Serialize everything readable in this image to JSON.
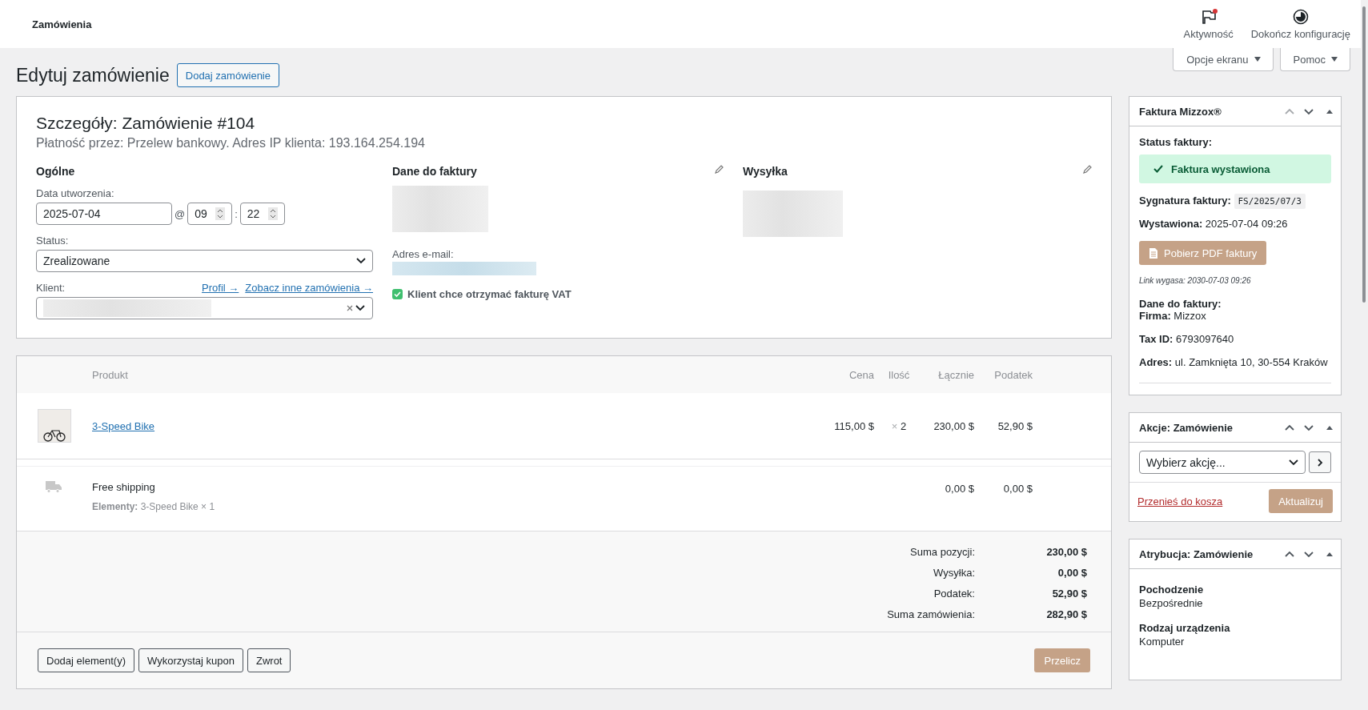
{
  "top_bar": {
    "title": "Zamówienia",
    "actions": [
      {
        "kind": "flag",
        "label": "Aktywność",
        "unread": true
      },
      {
        "kind": "progress",
        "label": "Dokończ konfigurację",
        "unread": false
      }
    ]
  },
  "screen_tabs": [
    "Opcje ekranu",
    "Pomoc"
  ],
  "page": {
    "title": "Edytuj zamówienie",
    "add_button": "Dodaj zamówienie"
  },
  "order": {
    "heading": "Szczegóły: Zamówienie #104",
    "subheading": "Płatność przez: Przelew bankowy. Adres IP klienta: 193.164.254.194",
    "general": {
      "heading": "Ogólne",
      "date_label": "Data utworzenia:",
      "date": "2025-07-04",
      "at": "@",
      "hour": "09",
      "colon": ":",
      "minute": "22",
      "status_label": "Status:",
      "status": "Zrealizowane",
      "client_label": "Klient:",
      "links": [
        "Profil →",
        "Zobacz inne zamówienia →"
      ]
    },
    "billing": {
      "heading": "Dane do faktury",
      "email_label": "Adres e-mail:",
      "vat_label": "Klient chce otrzymać fakturę VAT",
      "vat_checked": true
    },
    "shipping": {
      "heading": "Wysyłka"
    }
  },
  "items": {
    "columns": [
      "Produkt",
      "Cena",
      "Ilość",
      "Łącznie",
      "Podatek"
    ],
    "rows": [
      {
        "kind": "product",
        "name": "3-Speed Bike",
        "cost": "115,00 $",
        "qty_sign": "×",
        "qty": "2",
        "total": "230,00 $",
        "tax": "52,90 $"
      },
      {
        "kind": "shipping",
        "name": "Free shipping",
        "meta_label": "Elementy:",
        "meta_value": "3-Speed Bike × 1",
        "total": "0,00 $",
        "tax": "0,00 $"
      }
    ],
    "totals": [
      {
        "label": "Suma pozycji:",
        "value": "230,00 $"
      },
      {
        "label": "Wysyłka:",
        "value": "0,00 $"
      },
      {
        "label": "Podatek:",
        "value": "52,90 $"
      },
      {
        "label": "Suma zamówienia:",
        "value": "282,90 $"
      }
    ],
    "buttons": [
      "Dodaj element(y)",
      "Wykorzystaj kupon",
      "Zwrot"
    ],
    "recalc": "Przelicz"
  },
  "invoice": {
    "title": "Faktura Mizzox®",
    "status_label": "Status faktury:",
    "status": "Faktura wystawiona",
    "issued_ok": true,
    "signature_label": "Sygnatura faktury:",
    "signature": "FS/2025/07/3",
    "issued_label": "Wystawiona:",
    "issued": "2025-07-04 09:26",
    "pdf_button": "Pobierz PDF faktury",
    "expiry": "Link wygasa: 2030-07-03 09:26",
    "data_heading": "Dane do faktury:",
    "fields": [
      {
        "label": "Firma:",
        "value": "Mizzox"
      },
      {
        "label": "Tax ID:",
        "value": "6793097640"
      },
      {
        "label": "Adres:",
        "value": "ul. Zamknięta 10, 30-554 Kraków"
      }
    ]
  },
  "actions": {
    "title": "Akcje: Zamówienie",
    "select": "Wybierz akcję...",
    "trash": "Przenieś do kosza",
    "update": "Aktualizuj"
  },
  "attribution": {
    "title": "Atrybucja: Zamówienie",
    "fields": [
      {
        "label": "Pochodzenie",
        "value": "Bezpośrednie"
      },
      {
        "label": "Rodzaj urządzenia",
        "value": "Komputer"
      }
    ]
  }
}
